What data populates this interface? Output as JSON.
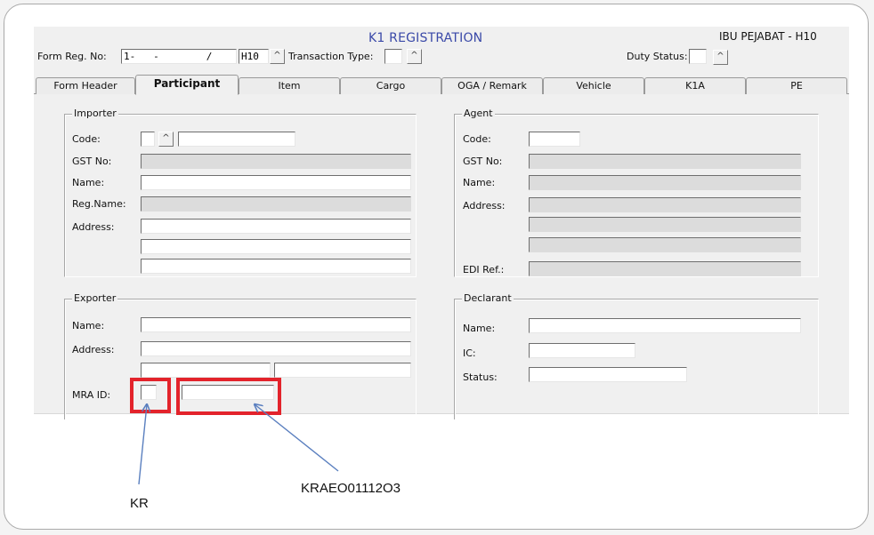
{
  "window": {
    "title": "K1 REGISTRATION",
    "office": "IBU PEJABAT  - H10"
  },
  "header": {
    "form_reg_label": "Form Reg. No:",
    "form_reg_value": "1-   -        /",
    "form_reg_code": "H10",
    "transaction_type_label": "Transaction Type:",
    "duty_status_label": "Duty Status:",
    "lookup_glyph": "^"
  },
  "tabs": [
    {
      "label": "Form Header",
      "active": false
    },
    {
      "label": "Participant",
      "active": true
    },
    {
      "label": "Item",
      "active": false
    },
    {
      "label": "Cargo",
      "active": false
    },
    {
      "label": "OGA / Remark",
      "active": false
    },
    {
      "label": "Vehicle",
      "active": false
    },
    {
      "label": "K1A",
      "active": false
    },
    {
      "label": "PE",
      "active": false
    }
  ],
  "importer": {
    "title": "Importer",
    "code_label": "Code:",
    "gst_label": "GST No:",
    "name_label": "Name:",
    "reg_name_label": "Reg.Name:",
    "address_label": "Address:"
  },
  "agent": {
    "title": "Agent",
    "code_label": "Code:",
    "gst_label": "GST No:",
    "name_label": "Name:",
    "address_label": "Address:",
    "edi_label": "EDI Ref.:"
  },
  "exporter": {
    "title": "Exporter",
    "name_label": "Name:",
    "address_label": "Address:",
    "mra_label": "MRA ID:"
  },
  "declarant": {
    "title": "Declarant",
    "name_label": "Name:",
    "ic_label": "IC:",
    "status_label": "Status:"
  },
  "annotations": {
    "mra_prefix": "KR",
    "mra_number": "KRAEO01112O3"
  },
  "colors": {
    "highlight": "#e3232b",
    "arrow": "#5a7fbf",
    "title": "#3a49a8"
  }
}
